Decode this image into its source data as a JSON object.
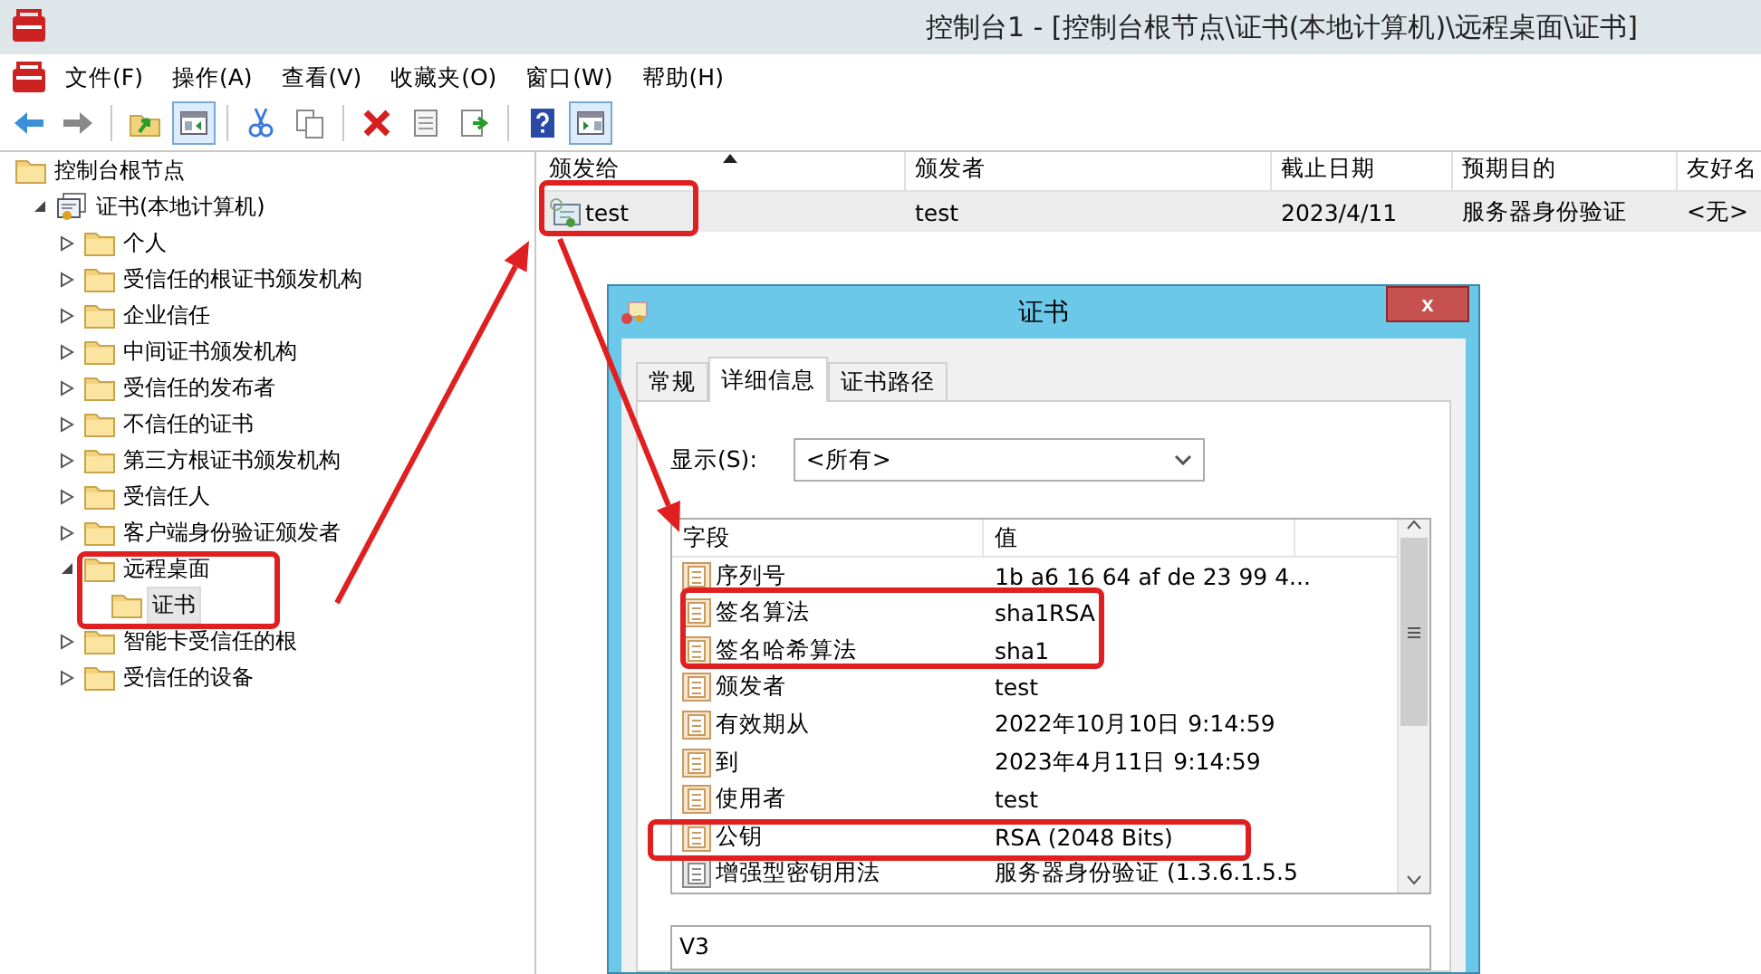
{
  "window": {
    "title": "控制台1 - [控制台根节点\\证书(本地计算机)\\远程桌面\\证书]"
  },
  "menu": [
    "文件(F)",
    "操作(A)",
    "查看(V)",
    "收藏夹(O)",
    "窗口(W)",
    "帮助(H)"
  ],
  "toolbar": [
    {
      "kind": "back",
      "pressed": false
    },
    {
      "kind": "forward",
      "pressed": false
    },
    {
      "kind": "sep"
    },
    {
      "kind": "up",
      "pressed": false
    },
    {
      "kind": "tree",
      "pressed": true
    },
    {
      "kind": "sep"
    },
    {
      "kind": "cut",
      "pressed": false
    },
    {
      "kind": "copy",
      "pressed": false
    },
    {
      "kind": "sep"
    },
    {
      "kind": "delete",
      "pressed": false
    },
    {
      "kind": "properties",
      "pressed": false
    },
    {
      "kind": "export",
      "pressed": false
    },
    {
      "kind": "sep"
    },
    {
      "kind": "help",
      "pressed": false
    },
    {
      "kind": "actions",
      "pressed": true
    }
  ],
  "tree": {
    "items": [
      {
        "label": "控制台根节点",
        "kind": "folder",
        "selected": false,
        "children": [
          {
            "label": "证书(本地计算机)",
            "kind": "store",
            "expanded": true,
            "selected": false,
            "children": [
              {
                "label": "个人",
                "kind": "folder",
                "expanded": false,
                "selected": false
              },
              {
                "label": "受信任的根证书颁发机构",
                "kind": "folder",
                "expanded": false,
                "selected": false
              },
              {
                "label": "企业信任",
                "kind": "folder",
                "expanded": false,
                "selected": false
              },
              {
                "label": "中间证书颁发机构",
                "kind": "folder",
                "expanded": false,
                "selected": false
              },
              {
                "label": "受信任的发布者",
                "kind": "folder",
                "expanded": false,
                "selected": false
              },
              {
                "label": "不信任的证书",
                "kind": "folder",
                "expanded": false,
                "selected": false
              },
              {
                "label": "第三方根证书颁发机构",
                "kind": "folder",
                "expanded": false,
                "selected": false
              },
              {
                "label": "受信任人",
                "kind": "folder",
                "expanded": false,
                "selected": false
              },
              {
                "label": "客户端身份验证颁发者",
                "kind": "folder",
                "expanded": false,
                "selected": false
              },
              {
                "label": "远程桌面",
                "kind": "folder",
                "expanded": true,
                "selected": false,
                "children": [
                  {
                    "label": "证书",
                    "kind": "folder",
                    "selected": true
                  }
                ]
              },
              {
                "label": "智能卡受信任的根",
                "kind": "folder",
                "expanded": false,
                "selected": false
              },
              {
                "label": "受信任的设备",
                "kind": "folder",
                "expanded": false,
                "selected": false
              }
            ]
          }
        ]
      }
    ]
  },
  "list": {
    "columns": [
      {
        "label": "颁发给",
        "sorted": true
      },
      {
        "label": "颁发者",
        "sorted": false
      },
      {
        "label": "截止日期",
        "sorted": false
      },
      {
        "label": "预期目的",
        "sorted": false
      },
      {
        "label": "友好名",
        "sorted": false
      }
    ],
    "rows": [
      {
        "cells": [
          "test",
          "test",
          "2023/4/11",
          "服务器身份验证",
          "<无>"
        ],
        "selected": true
      }
    ]
  },
  "dialog": {
    "title": "证书",
    "close": "x",
    "tabs": [
      {
        "label": "常规",
        "selected": false
      },
      {
        "label": "详细信息",
        "selected": true
      },
      {
        "label": "证书路径",
        "selected": false
      }
    ],
    "show_label": "显示(S):",
    "show_value": "<所有>",
    "fields": {
      "columns": [
        "字段",
        "值"
      ],
      "rows": [
        {
          "field": "序列号",
          "value": "1b a6 16 64 af de 23 99 4...",
          "kind": "property"
        },
        {
          "field": "签名算法",
          "value": "sha1RSA",
          "kind": "property"
        },
        {
          "field": "签名哈希算法",
          "value": "sha1",
          "kind": "property"
        },
        {
          "field": "颁发者",
          "value": "test",
          "kind": "property"
        },
        {
          "field": "有效期从",
          "value": "2022年10月10日 9:14:59",
          "kind": "property"
        },
        {
          "field": "到",
          "value": "2023年4月11日 9:14:59",
          "kind": "property"
        },
        {
          "field": "使用者",
          "value": "test",
          "kind": "property"
        },
        {
          "field": "公钥",
          "value": "RSA (2048 Bits)",
          "kind": "property"
        },
        {
          "field": "增强型密钥用法",
          "value": "服务器身份验证 (1.3.6.1.5.5",
          "kind": "extension"
        }
      ]
    },
    "detail_value": "V3"
  }
}
